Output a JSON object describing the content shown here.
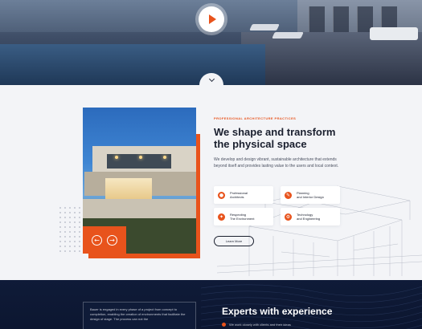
{
  "hero": {
    "play_label": "Play video"
  },
  "about": {
    "eyebrow": "PROFESSIONAL ARCHITECTURE PRACTICES",
    "heading_part1": "We shape and ",
    "heading_bold1": "transform",
    "heading_part2": "the physical ",
    "heading_bold2": "space",
    "lead": "We develop and design vibrant, sustainable architecture that extends beyond itself and provides lasting value to the users and local context.",
    "features": [
      {
        "label": "Professional\nArchitects",
        "icon": "architect-icon"
      },
      {
        "label": "Planning\nand Interior Design",
        "icon": "planning-icon"
      },
      {
        "label": "Respecting\nThe Environment",
        "icon": "leaf-icon"
      },
      {
        "label": "Technology\nand Engineering",
        "icon": "gear-icon"
      }
    ],
    "learn_more": "Learn More",
    "prev_arrow": "←",
    "next_arrow": "→"
  },
  "experts": {
    "card_text": "Bauer is engaged in every phase of a project from concept to completion, enabling the creation of environments that facilitate the design of stage. The process can not the",
    "heading_regular": " with experience",
    "heading_bold": "Experts",
    "bullet": "We work closely with clients and their ideas"
  },
  "colors": {
    "accent": "#e8531c",
    "dark": "#0f1b38"
  }
}
